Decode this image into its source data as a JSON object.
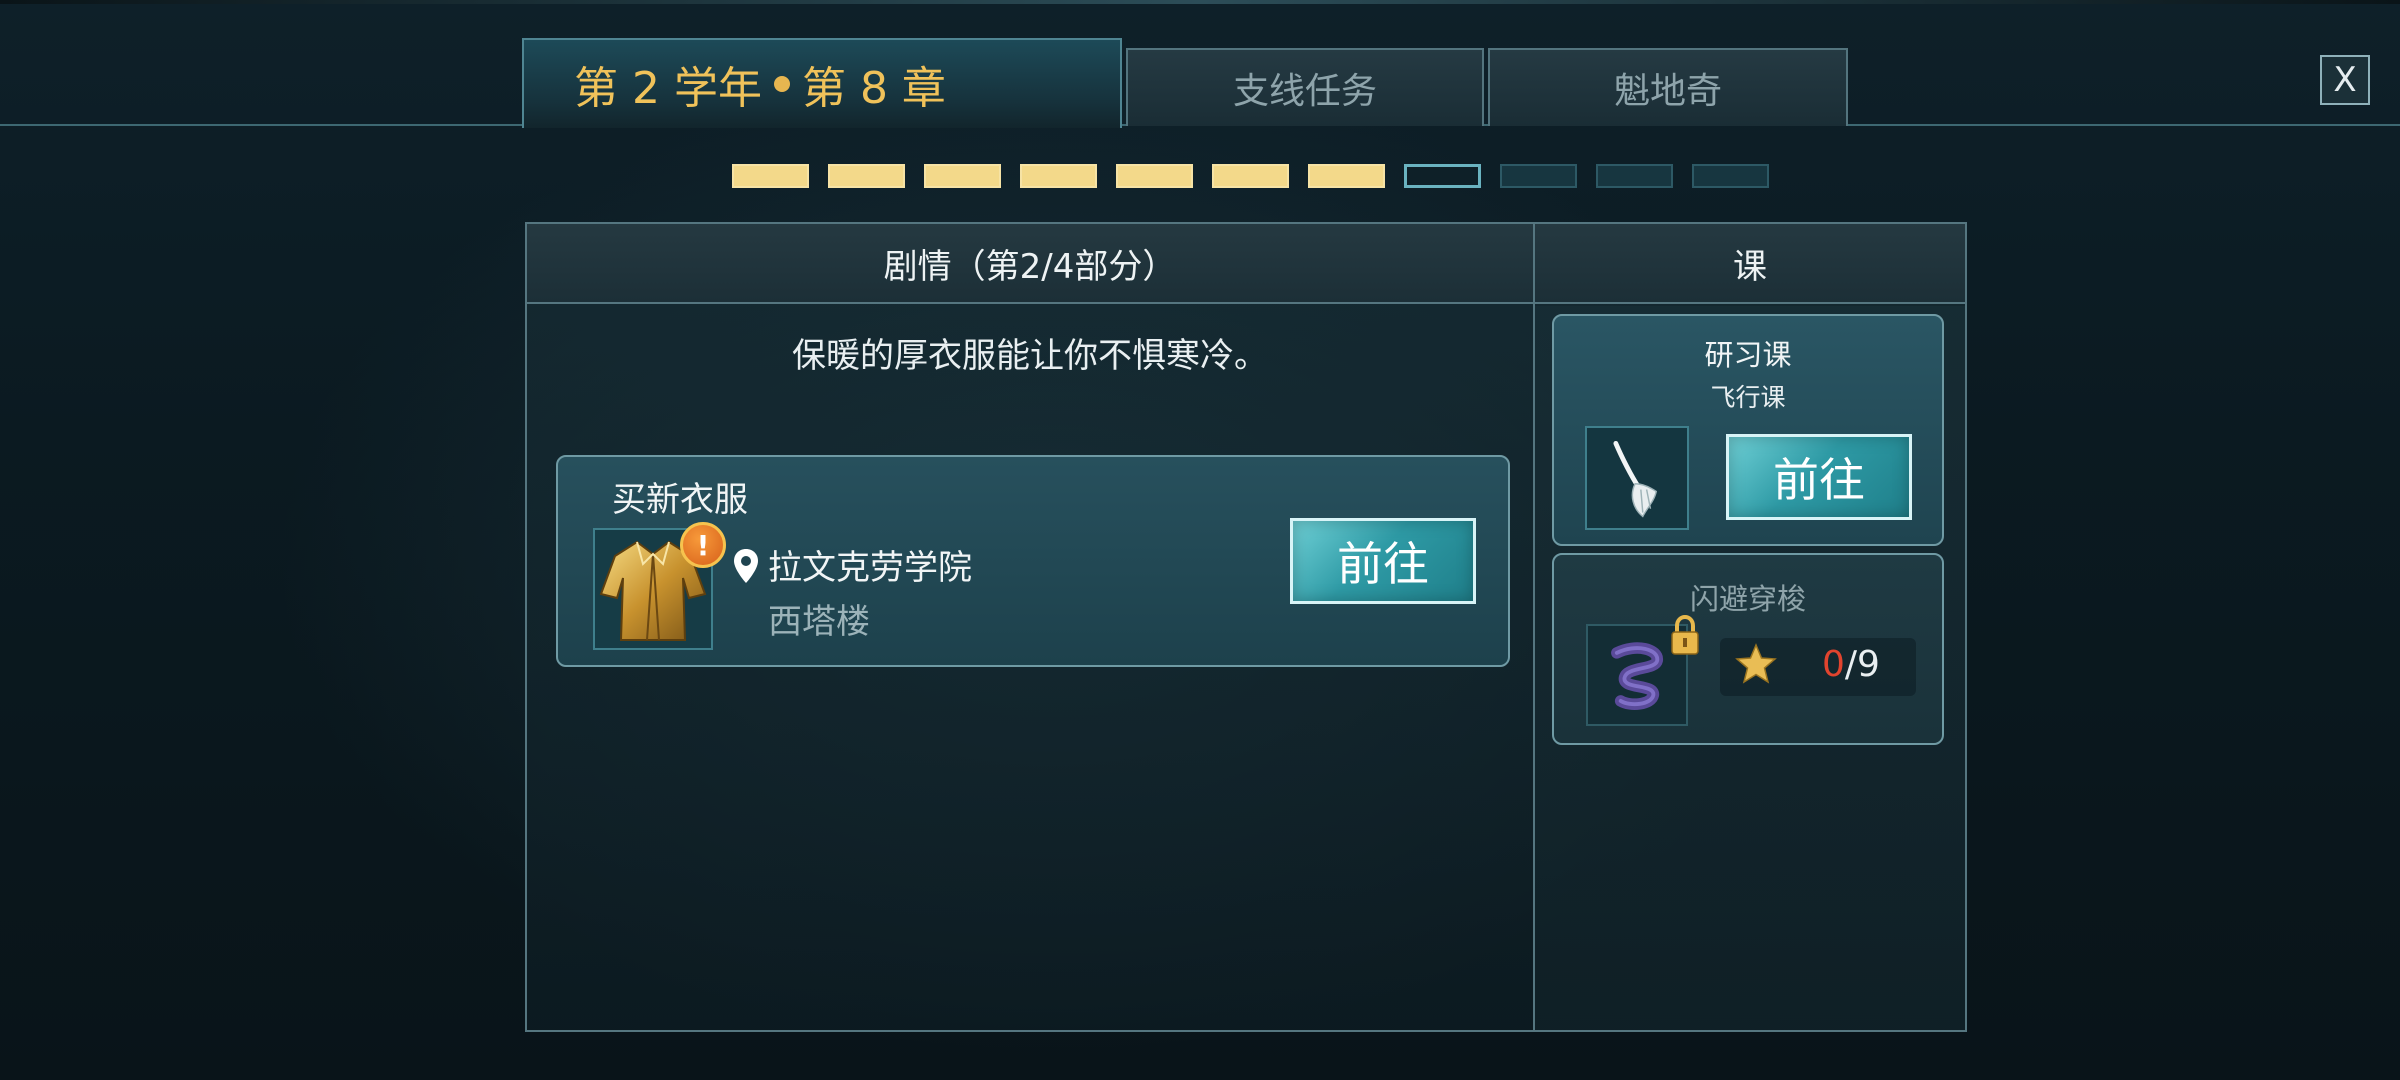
{
  "tabs": {
    "main": {
      "year_label": "第 2 学年",
      "chapter_label": "第 8 章"
    },
    "side_quests": "支线任务",
    "quidditch": "魁地奇"
  },
  "close_label": "X",
  "progress": {
    "total": 11,
    "done": 7,
    "current": 8
  },
  "story": {
    "header": "剧情（第2/4部分）",
    "description": "保暖的厚衣服能让你不惧寒冷。",
    "quest": {
      "title": "买新衣服",
      "icon": "robe-icon",
      "alert": "!",
      "location_primary": "拉文克劳学院",
      "location_secondary": "西塔楼",
      "go_label": "前往"
    }
  },
  "classes": {
    "header": "课",
    "study": {
      "title": "研习课",
      "subtitle": "飞行课",
      "icon": "broom-icon",
      "go_label": "前往"
    },
    "locked": {
      "title": "闪避穿梭",
      "icon": "swirl-icon",
      "score_current": "0",
      "score_sep": "/",
      "score_total": "9"
    }
  },
  "colors": {
    "gold": "#f0c25a",
    "progress_done": "#f3d98a",
    "button_teal": "#2e9aa5",
    "score_red": "#e2442e"
  }
}
